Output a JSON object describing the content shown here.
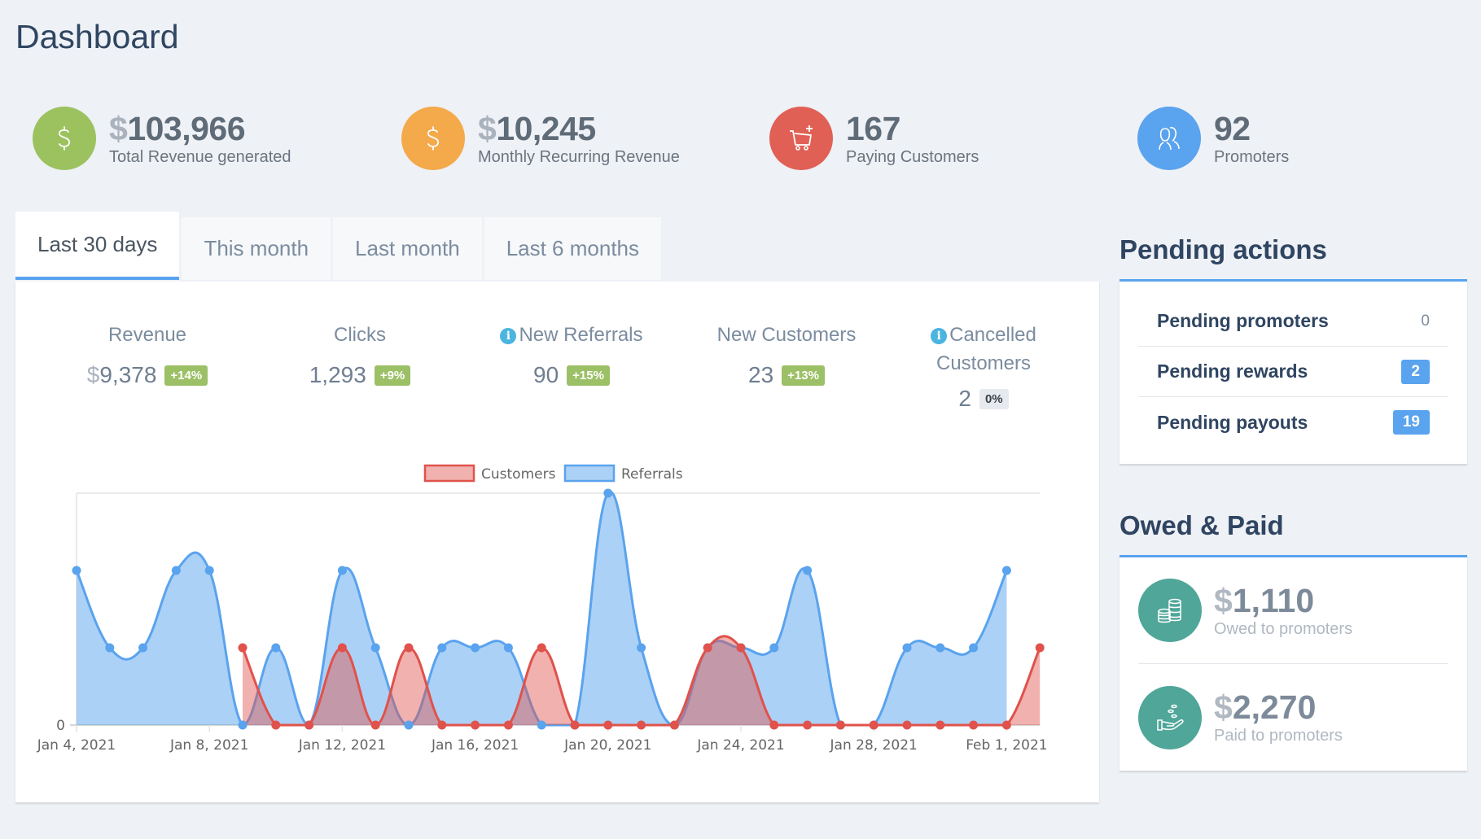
{
  "header": {
    "title": "Dashboard"
  },
  "stats": [
    {
      "currency": "$",
      "value": "103,966",
      "label": "Total Revenue generated",
      "icon": "dollar-icon",
      "color": "#9bc25f"
    },
    {
      "currency": "$",
      "value": "10,245",
      "label": "Monthly Recurring Revenue",
      "icon": "dollar-icon",
      "color": "#f4a94a"
    },
    {
      "currency": "",
      "value": "167",
      "label": "Paying Customers",
      "icon": "cart-icon",
      "color": "#e06055"
    },
    {
      "currency": "",
      "value": "92",
      "label": "Promoters",
      "icon": "users-icon",
      "color": "#5aa3ee"
    }
  ],
  "tabs": [
    {
      "label": "Last 30 days",
      "active": true
    },
    {
      "label": "This month",
      "active": false
    },
    {
      "label": "Last month",
      "active": false
    },
    {
      "label": "Last 6 months",
      "active": false
    }
  ],
  "kpis": [
    {
      "label": "Revenue",
      "currency": "$",
      "value": "9,378",
      "change": "+14%",
      "info": false
    },
    {
      "label": "Clicks",
      "currency": "",
      "value": "1,293",
      "change": "+9%",
      "info": false
    },
    {
      "label": "New Referrals",
      "currency": "",
      "value": "90",
      "change": "+15%",
      "info": true
    },
    {
      "label": "New Customers",
      "currency": "",
      "value": "23",
      "change": "+13%",
      "info": false
    },
    {
      "label_line1": "Cancelled",
      "label_line2": "Customers",
      "currency": "",
      "value": "2",
      "change": "0%",
      "info": true
    }
  ],
  "info_glyph": "i",
  "chart_data": {
    "type": "area",
    "title": "",
    "xlabel": "",
    "ylabel": "",
    "ylim": [
      0,
      3
    ],
    "y_tick_labels": [
      "0"
    ],
    "x": [
      "Jan 4",
      "Jan 5",
      "Jan 6",
      "Jan 7",
      "Jan 8",
      "Jan 9",
      "Jan 10",
      "Jan 11",
      "Jan 12",
      "Jan 13",
      "Jan 14",
      "Jan 15",
      "Jan 16",
      "Jan 17",
      "Jan 18",
      "Jan 19",
      "Jan 20",
      "Jan 21",
      "Jan 22",
      "Jan 23",
      "Jan 24",
      "Jan 25",
      "Jan 26",
      "Jan 27",
      "Jan 28",
      "Jan 29",
      "Jan 30",
      "Jan 31",
      "Feb 1",
      "Feb 2"
    ],
    "x_tick_labels": [
      "Jan 4, 2021",
      "Jan 8, 2021",
      "Jan 12, 2021",
      "Jan 16, 2021",
      "Jan 20, 2021",
      "Jan 24, 2021",
      "Jan 28, 2021",
      "Feb 1, 2021"
    ],
    "x_tick_every": 4,
    "legend_position": "top",
    "grid": false,
    "series": [
      {
        "name": "Customers",
        "color": "#e0524b",
        "fill": "rgba(224,82,75,0.45)",
        "values": [
          null,
          null,
          null,
          null,
          null,
          1,
          0,
          0,
          1,
          0,
          1,
          0,
          0,
          0,
          1,
          0,
          0,
          0,
          0,
          1,
          1,
          0,
          0,
          0,
          0,
          0,
          0,
          0,
          0,
          1
        ]
      },
      {
        "name": "Referrals",
        "color": "#5aa3ee",
        "fill": "rgba(90,163,238,0.5)",
        "values": [
          2,
          1,
          1,
          2,
          2,
          0,
          1,
          0,
          2,
          1,
          0,
          1,
          1,
          1,
          0,
          0,
          3,
          1,
          0,
          1,
          1,
          1,
          2,
          0,
          0,
          1,
          1,
          1,
          2,
          null
        ]
      }
    ]
  },
  "pending": {
    "title": "Pending actions",
    "rows": [
      {
        "label": "Pending promoters",
        "count": "0",
        "highlight": false
      },
      {
        "label": "Pending rewards",
        "count": "2",
        "highlight": true
      },
      {
        "label": "Pending payouts",
        "count": "19",
        "highlight": true
      }
    ]
  },
  "owed_paid": {
    "title": "Owed & Paid",
    "rows": [
      {
        "currency": "$",
        "value": "1,110",
        "label": "Owed to promoters",
        "icon": "coins-icon"
      },
      {
        "currency": "$",
        "value": "2,270",
        "label": "Paid to promoters",
        "icon": "hand-coins-icon"
      }
    ]
  }
}
